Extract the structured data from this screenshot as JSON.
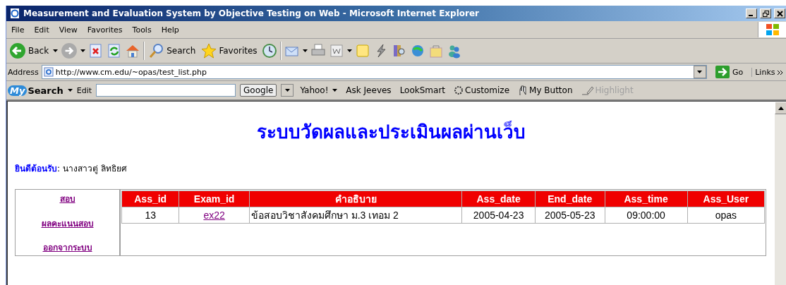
{
  "window": {
    "title": "Measurement and Evaluation System by Objective Testing on Web - Microsoft Internet Explorer"
  },
  "menu": [
    "File",
    "Edit",
    "View",
    "Favorites",
    "Tools",
    "Help"
  ],
  "toolbar": {
    "back": "Back",
    "search": "Search",
    "favorites": "Favorites"
  },
  "address": {
    "label": "Address",
    "url": "http://www.cm.edu/~opas/test_list.php",
    "go": "Go",
    "links": "Links"
  },
  "mysearch": {
    "logo_my": "My",
    "logo_search": "Search",
    "edit": "Edit",
    "google": "Google",
    "links": [
      {
        "label": "Yahoo!",
        "kind": "dropdown",
        "disabled": false
      },
      {
        "label": "Ask Jeeves",
        "kind": "plain",
        "disabled": false
      },
      {
        "label": "LookSmart",
        "kind": "plain",
        "disabled": false
      },
      {
        "label": "Customize",
        "kind": "customize",
        "disabled": false
      },
      {
        "label": "My Button",
        "kind": "hand",
        "disabled": false
      },
      {
        "label": "Highlight",
        "kind": "highlight",
        "disabled": true
      }
    ]
  },
  "page": {
    "heading": "ระบบวัดผลและประเมินผลผ่านเว็บ",
    "welcome_label": "ยินดีต้อนรับ",
    "welcome_name": " : นางสาวตู่ ลิทธิยศ",
    "nav": [
      "สอบ",
      "ผลคะแนนสอบ",
      "ออกจากระบบ"
    ],
    "table": {
      "columns": [
        "Ass_id",
        "Exam_id",
        "คำอธิบาย",
        "Ass_date",
        "End_date",
        "Ass_time",
        "Ass_User"
      ],
      "rows": [
        [
          {
            "text": "13",
            "kind": "text"
          },
          {
            "text": "ex22",
            "kind": "link"
          },
          {
            "text": "ข้อสอบวิชาสังคมศึกษา ม.3 เทอม 2",
            "kind": "description"
          },
          {
            "text": "2005-04-23",
            "kind": "text"
          },
          {
            "text": "2005-05-23",
            "kind": "text"
          },
          {
            "text": "09:00:00",
            "kind": "text"
          },
          {
            "text": "opas",
            "kind": "text"
          }
        ]
      ]
    }
  }
}
